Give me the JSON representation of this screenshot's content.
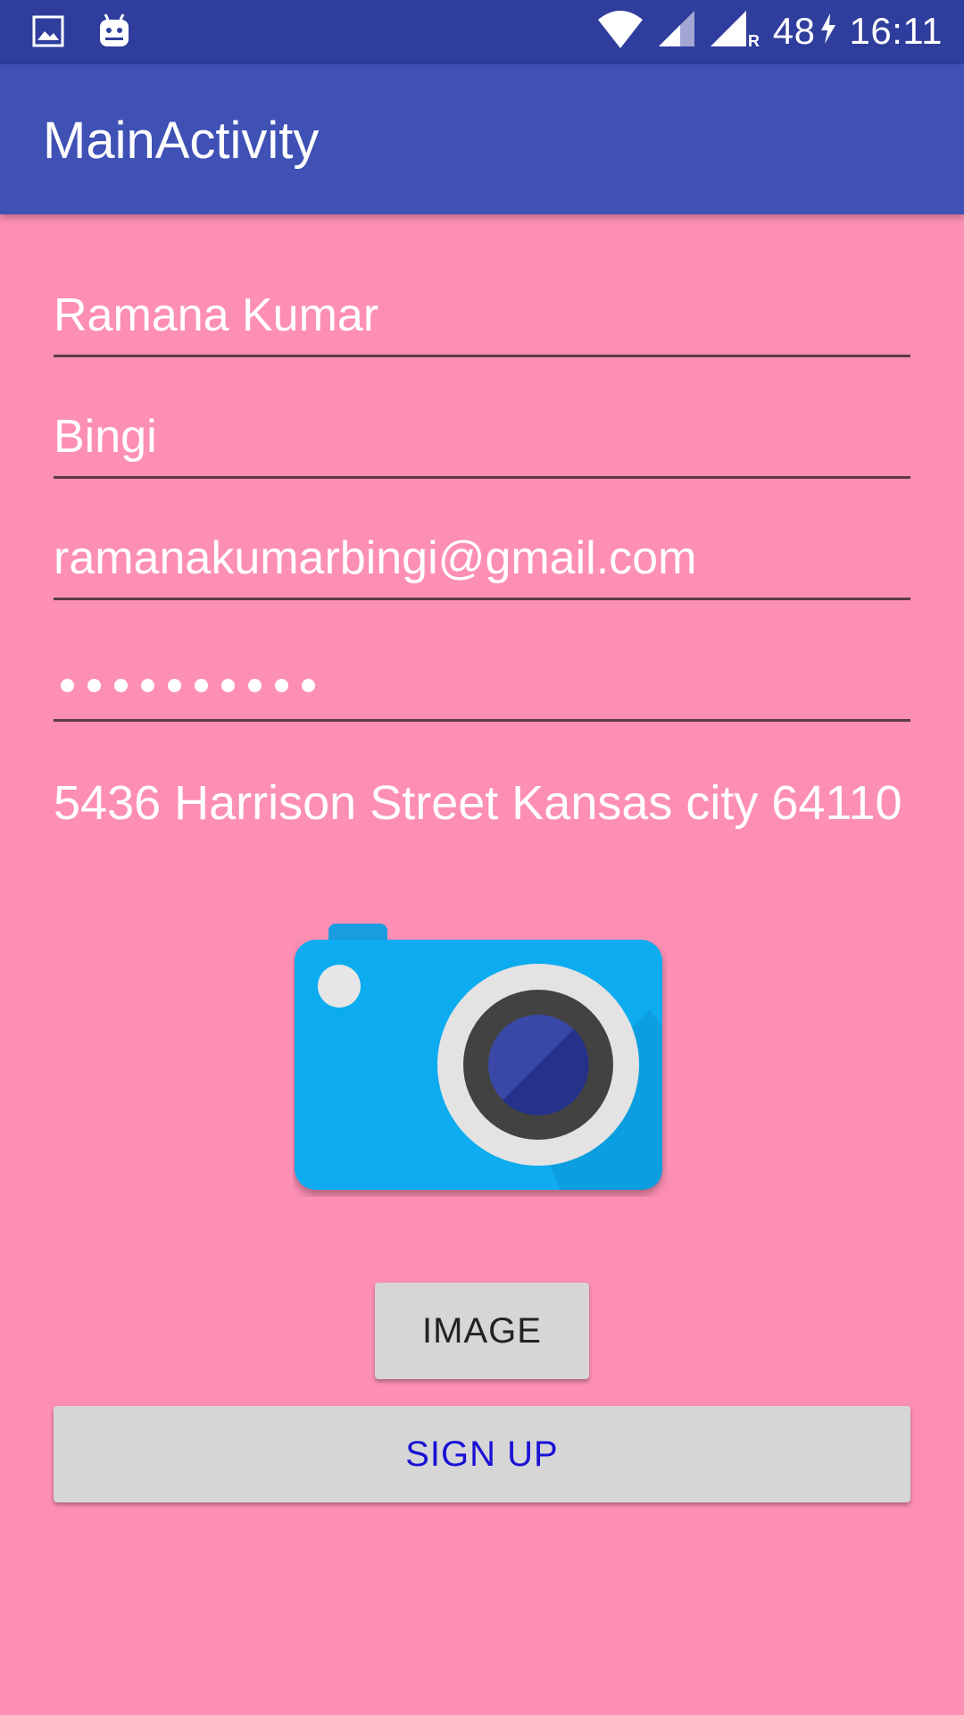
{
  "status_bar": {
    "icons": [
      "image-notification-icon",
      "android-notification-icon",
      "wifi-icon",
      "cell-signal-icon",
      "cell-signal-roaming-icon",
      "charging-icon"
    ],
    "battery": "48",
    "time": "16:11"
  },
  "app_bar": {
    "title": "MainActivity"
  },
  "form": {
    "first_name": "Ramana Kumar",
    "last_name": "Bingi",
    "email": "ramanakumarbingi@gmail.com",
    "password_dot_count": 10,
    "address": "5436 Harrison Street Kansas city 64110"
  },
  "buttons": {
    "image_label": "IMAGE",
    "signup_label": "SIGN UP"
  },
  "colors": {
    "status_bar": "#2f3d9c",
    "app_bar": "#3f51b5",
    "background": "#fd8fb4",
    "button": "#d6d6d6",
    "signup_text": "#1a11d6"
  }
}
